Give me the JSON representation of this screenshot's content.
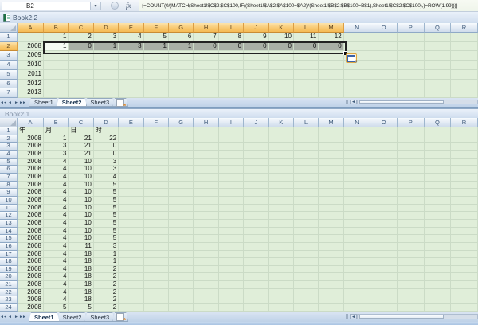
{
  "formula_bar": {
    "name_box": "B2",
    "fx_label": "fx",
    "formula": "{=COUNT(0/(MATCH(Sheet1!$C$2:$C$100,IF((Sheet1!$A$2:$A$100=$A2)*(Sheet1!$B$2:$B$100=B$1),Sheet1!$C$2:$C$100),)=ROW(1:99)))}"
  },
  "icons": {
    "tab_first": "◄◄",
    "tab_prev": "◄",
    "tab_next": "►",
    "tab_last": "►►",
    "name_dropdown": "▾"
  },
  "colors": {
    "cell_bg": "#E0EED9",
    "selected_fill": "#A9AFA6",
    "highlight_header": "#F8C86F",
    "normal_header": "#DDE7F2"
  },
  "window1": {
    "title": "Book2:2",
    "columns": [
      "A",
      "B",
      "C",
      "D",
      "E",
      "F",
      "G",
      "H",
      "I",
      "J",
      "K",
      "L",
      "M",
      "N",
      "O",
      "P",
      "Q",
      "R"
    ],
    "rows": [
      [
        "",
        "1",
        "2",
        "3",
        "4",
        "5",
        "6",
        "7",
        "8",
        "9",
        "10",
        "11",
        "12"
      ],
      [
        "2008",
        "1",
        "0",
        "1",
        "3",
        "1",
        "1",
        "0",
        "0",
        "0",
        "0",
        "0",
        "0"
      ],
      [
        "2009"
      ],
      [
        "2010"
      ],
      [
        "2011"
      ],
      [
        "2012"
      ],
      [
        "2013"
      ]
    ],
    "highlight": {
      "header_cols": 13,
      "header_row": 2
    },
    "selection": {
      "range": "B2:M2",
      "active_cell": "B2",
      "row": 2,
      "start_col_index": 1,
      "end_col_index": 12
    },
    "tabs": [
      "Sheet1",
      "Sheet2",
      "Sheet3"
    ],
    "active_tab": "Sheet2"
  },
  "window2": {
    "title": "Book2:1",
    "columns": [
      "A",
      "B",
      "C",
      "D",
      "E",
      "F",
      "G",
      "H",
      "I",
      "J",
      "K",
      "L",
      "M",
      "N",
      "O",
      "P",
      "Q",
      "R"
    ],
    "rows": [
      [
        "年",
        "月",
        "日",
        "时"
      ],
      [
        "2008",
        "1",
        "21",
        "22"
      ],
      [
        "2008",
        "3",
        "21",
        "0"
      ],
      [
        "2008",
        "3",
        "21",
        "0"
      ],
      [
        "2008",
        "4",
        "10",
        "3"
      ],
      [
        "2008",
        "4",
        "10",
        "3"
      ],
      [
        "2008",
        "4",
        "10",
        "4"
      ],
      [
        "2008",
        "4",
        "10",
        "5"
      ],
      [
        "2008",
        "4",
        "10",
        "5"
      ],
      [
        "2008",
        "4",
        "10",
        "5"
      ],
      [
        "2008",
        "4",
        "10",
        "5"
      ],
      [
        "2008",
        "4",
        "10",
        "5"
      ],
      [
        "2008",
        "4",
        "10",
        "5"
      ],
      [
        "2008",
        "4",
        "10",
        "5"
      ],
      [
        "2008",
        "4",
        "10",
        "5"
      ],
      [
        "2008",
        "4",
        "11",
        "3"
      ],
      [
        "2008",
        "4",
        "18",
        "1"
      ],
      [
        "2008",
        "4",
        "18",
        "1"
      ],
      [
        "2008",
        "4",
        "18",
        "2"
      ],
      [
        "2008",
        "4",
        "18",
        "2"
      ],
      [
        "2008",
        "4",
        "18",
        "2"
      ],
      [
        "2008",
        "4",
        "18",
        "2"
      ],
      [
        "2008",
        "4",
        "18",
        "2"
      ],
      [
        "2008",
        "5",
        "5",
        "2"
      ]
    ],
    "highlight": {
      "header_cols": 0,
      "header_row": 0
    },
    "tabs": [
      "Sheet1",
      "Sheet2",
      "Sheet3"
    ],
    "active_tab": "Sheet1"
  }
}
